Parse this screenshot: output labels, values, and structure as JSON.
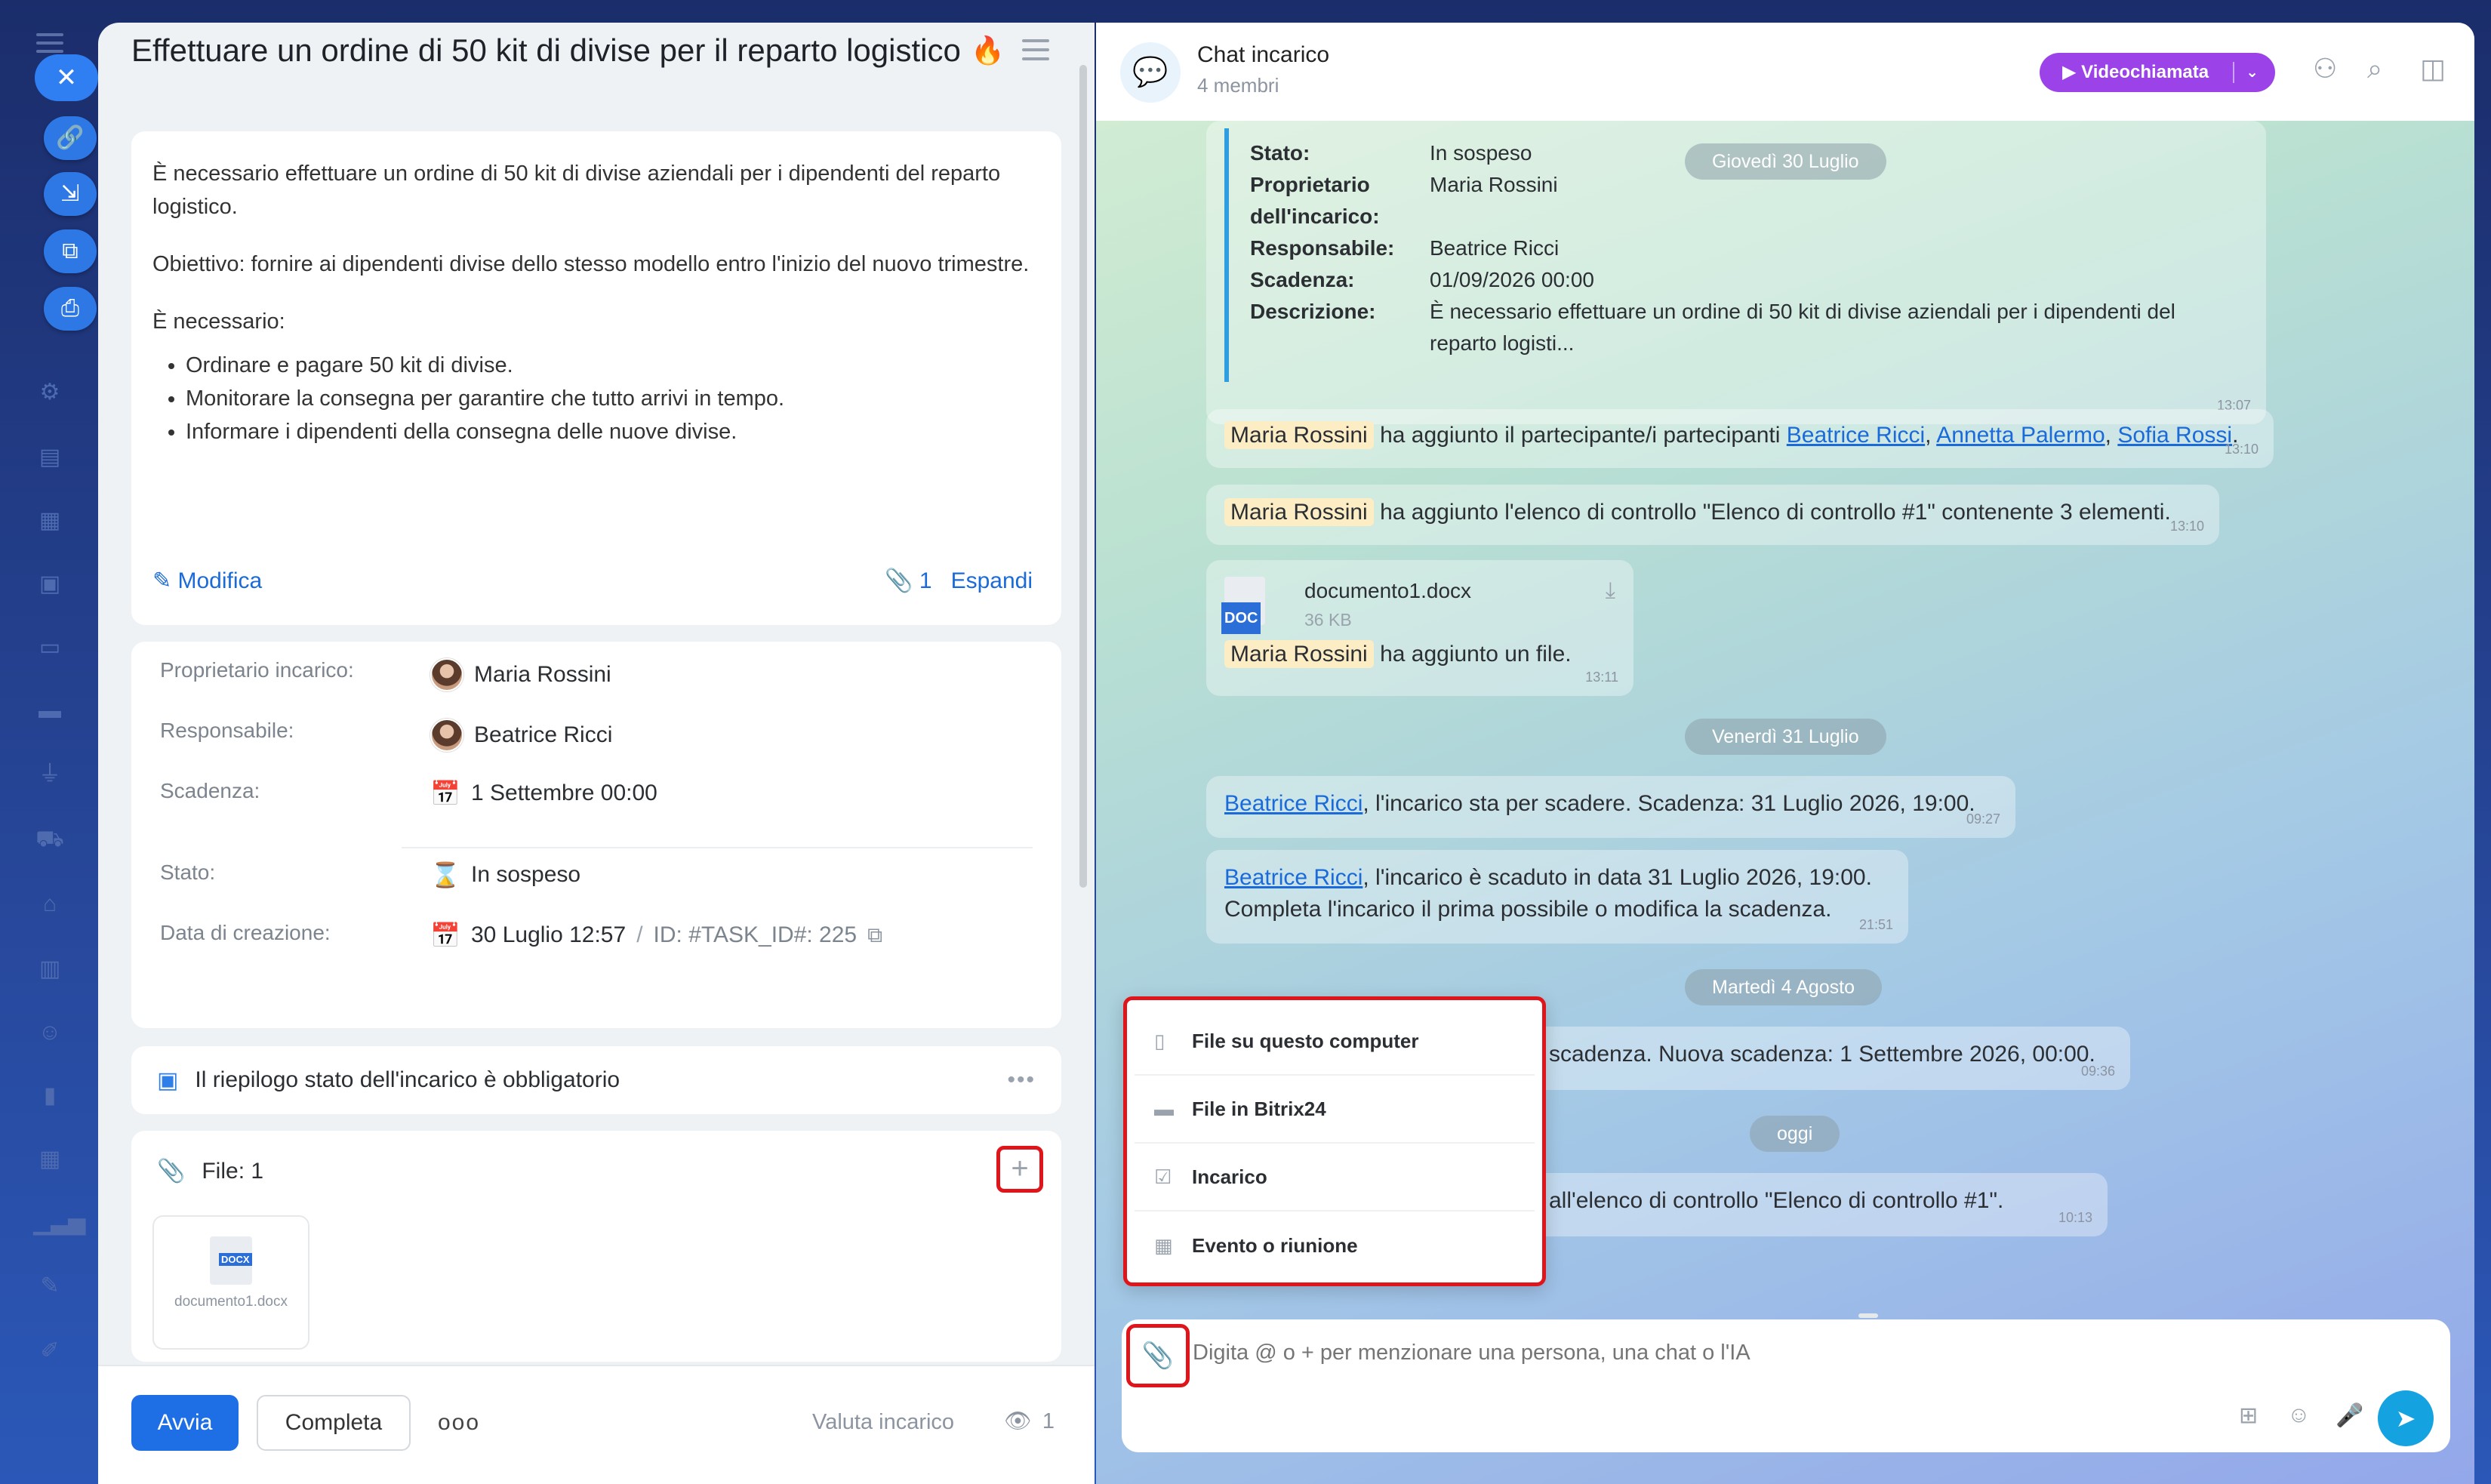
{
  "task": {
    "title": "Effettuare un ordine di 50 kit di divise per il reparto logistico",
    "description": {
      "p1": "È necessario effettuare un ordine di 50 kit di divise aziendali per i dipendenti del reparto logistico.",
      "p2": "Obiettivo: fornire ai dipendenti divise dello stesso modello entro l'inizio del nuovo trimestre.",
      "p3": "È necessario:",
      "bullets": [
        "Ordinare e pagare 50 kit di divise.",
        "Monitorare la consegna per garantire che tutto arrivi in tempo.",
        "Informare i dipendenti della consegna delle nuove divise."
      ],
      "edit_label": "Modifica",
      "attachments_count": "1",
      "expand_label": "Espandi"
    },
    "info": {
      "owner_label": "Proprietario incarico:",
      "owner_value": "Maria Rossini",
      "responsible_label": "Responsabile:",
      "responsible_value": "Beatrice Ricci",
      "deadline_label": "Scadenza:",
      "deadline_value": "1 Settembre 00:00",
      "status_label": "Stato:",
      "status_value": "In sospeso",
      "created_label": "Data di creazione:",
      "created_value": "30 Luglio 12:57",
      "id_value": "ID: #TASK_ID#: 225"
    },
    "summary_text": "Il riepilogo stato dell'incarico è obbligatorio",
    "files": {
      "title": "File: 1",
      "items": [
        "documento1.docx"
      ]
    },
    "footer": {
      "start": "Avvia",
      "complete": "Completa",
      "rate": "Valuta incarico",
      "views": "1"
    }
  },
  "chat": {
    "title": "Chat incarico",
    "members": "4 membri",
    "video_button": "Videochiamata",
    "card": {
      "rows": [
        {
          "k": "Stato:",
          "v": "In sospeso"
        },
        {
          "k": "Proprietario dell'incarico:",
          "v": "Maria Rossini"
        },
        {
          "k": "Responsabile:",
          "v": "Beatrice Ricci"
        },
        {
          "k": "Scadenza:",
          "v": "01/09/2026 00:00"
        },
        {
          "k": "Descrizione:",
          "v": "È necessario effettuare un ordine di 50 kit di divise aziendali per i dipendenti del reparto logisti..."
        }
      ],
      "time": "13:07"
    },
    "dates": {
      "d1": "Giovedì 30 Luglio",
      "d2": "Venerdì 31 Luglio",
      "d3": "Martedì 4 Agosto",
      "d4": "oggi"
    },
    "messages": {
      "m1_name": "Maria Rossini",
      "m1_text": "ha aggiunto il partecipante/i partecipanti",
      "m1_p1": "Beatrice Ricci",
      "m1_p2": "Annetta Palermo",
      "m1_p3": "Sofia Rossi",
      "m1_time": "13:10",
      "m2_name": "Maria Rossini",
      "m2_text": "ha aggiunto l'elenco di controllo \"Elenco di controllo #1\" contenente 3 elementi.",
      "m2_time": "13:10",
      "m3_file": "documento1.docx",
      "m3_size": "36 KB",
      "m3_badge": "DOC",
      "m3_name": "Maria Rossini",
      "m3_text": "ha aggiunto un file.",
      "m3_time": "13:11",
      "m4_name": "Beatrice Ricci",
      "m4_text": ", l'incarico sta per scadere. Scadenza: 31 Luglio 2026, 19:00.",
      "m4_time": "09:27",
      "m5_name": "Beatrice Ricci",
      "m5_text": ", l'incarico è scaduto in data 31 Luglio 2026, 19:00.",
      "m5_text2": "Completa l'incarico il prima possibile o modifica la scadenza.",
      "m5_time": "21:51",
      "m6_text": "scadenza. Nuova scadenza: 1 Settembre 2026, 00:00.",
      "m6_time": "09:36",
      "m7_text": "all'elenco di controllo \"Elenco di controllo #1\".",
      "m7_time": "10:13"
    },
    "attach_menu": [
      {
        "label": "File su questo computer",
        "icon": "file-icon"
      },
      {
        "label": "File in Bitrix24",
        "icon": "drive-icon"
      },
      {
        "label": "Incarico",
        "icon": "task-icon"
      },
      {
        "label": "Evento o riunione",
        "icon": "calendar-icon"
      }
    ],
    "input_placeholder": "Digita @ o + per menzionare una persona, una chat o l'IA"
  },
  "colors": {
    "accent": "#1e6ee6",
    "video": "#9b43e8",
    "highlight": "#e0151b",
    "send": "#15a2e0"
  }
}
